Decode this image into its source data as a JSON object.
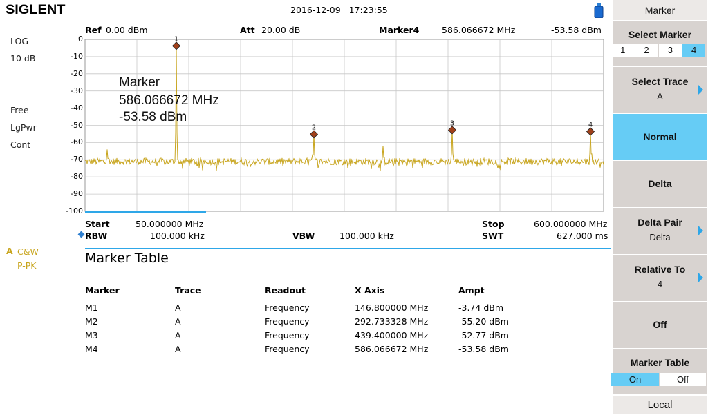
{
  "header": {
    "brand": "SIGLENT",
    "date": "2016-12-09",
    "time": "17:23:55"
  },
  "left_panel": {
    "scale_type": "LOG",
    "scale_div": "10 dB",
    "trigger": "Free",
    "detector": "LgPwr",
    "sweep_mode": "Cont",
    "trace_label": "A",
    "trace_mode": "C&W",
    "trace_detector": "P-PK"
  },
  "top_params": {
    "ref_label": "Ref",
    "ref_value": "0.00 dBm",
    "att_label": "Att",
    "att_value": "20.00 dB",
    "marker_label": "Marker4",
    "marker_freq": "586.066672 MHz",
    "marker_ampt": "-53.58 dBm"
  },
  "plot": {
    "y_ticks": [
      "0",
      "-10",
      "-20",
      "-30",
      "-40",
      "-50",
      "-60",
      "-70",
      "-80",
      "-90",
      "-100"
    ],
    "annotation_title": "Marker",
    "annotation_freq": "586.066672 MHz",
    "annotation_ampt": "-53.58 dBm",
    "trace_color": "#c8a51e",
    "marker_color": "#a0401a",
    "markers": [
      {
        "label": "1",
        "freq_mhz": 146.8,
        "ampt_dbm": -3.74
      },
      {
        "label": "2",
        "freq_mhz": 292.733328,
        "ampt_dbm": -55.2
      },
      {
        "label": "3",
        "freq_mhz": 439.4,
        "ampt_dbm": -52.77
      },
      {
        "label": "4",
        "freq_mhz": 586.066672,
        "ampt_dbm": -53.58
      }
    ],
    "noise_floor_dbm": -71,
    "extra_spurs": [
      {
        "freq_mhz": 73.5,
        "ampt_dbm": -64
      },
      {
        "freq_mhz": 366.3,
        "ampt_dbm": -62
      }
    ],
    "x_range_mhz": [
      50,
      600
    ],
    "y_range_dbm": [
      -100,
      0
    ]
  },
  "footer": {
    "start_label": "Start",
    "start_value": "50.000000 MHz",
    "stop_label": "Stop",
    "stop_value": "600.000000 MHz",
    "rbw_label": "RBW",
    "rbw_value": "100.000 kHz",
    "vbw_label": "VBW",
    "vbw_value": "100.000 kHz",
    "swt_label": "SWT",
    "swt_value": "627.000 ms"
  },
  "marker_table": {
    "title": "Marker Table",
    "headers": [
      "Marker",
      "Trace",
      "Readout",
      "X Axis",
      "Ampt"
    ],
    "rows": [
      [
        "M1",
        "A",
        "Frequency",
        "146.800000 MHz",
        "-3.74 dBm"
      ],
      [
        "M2",
        "A",
        "Frequency",
        "292.733328 MHz",
        "-55.20 dBm"
      ],
      [
        "M3",
        "A",
        "Frequency",
        "439.400000 MHz",
        "-52.77 dBm"
      ],
      [
        "M4",
        "A",
        "Frequency",
        "586.066672 MHz",
        "-53.58 dBm"
      ]
    ]
  },
  "softkeys": {
    "menu_title": "Marker",
    "select_marker": {
      "label": "Select Marker",
      "options": [
        "1",
        "2",
        "3",
        "4"
      ],
      "selected": "4"
    },
    "select_trace": {
      "label": "Select Trace",
      "value": "A"
    },
    "normal": {
      "label": "Normal"
    },
    "delta": {
      "label": "Delta"
    },
    "delta_pair": {
      "label": "Delta Pair",
      "value": "Delta"
    },
    "relative_to": {
      "label": "Relative To",
      "value": "4"
    },
    "off": {
      "label": "Off"
    },
    "marker_table": {
      "label": "Marker Table",
      "on": "On",
      "off": "Off",
      "selected": "On"
    },
    "local": "Local",
    "accent_color": "#66ccf5",
    "key_color": "#d8d3d0"
  }
}
